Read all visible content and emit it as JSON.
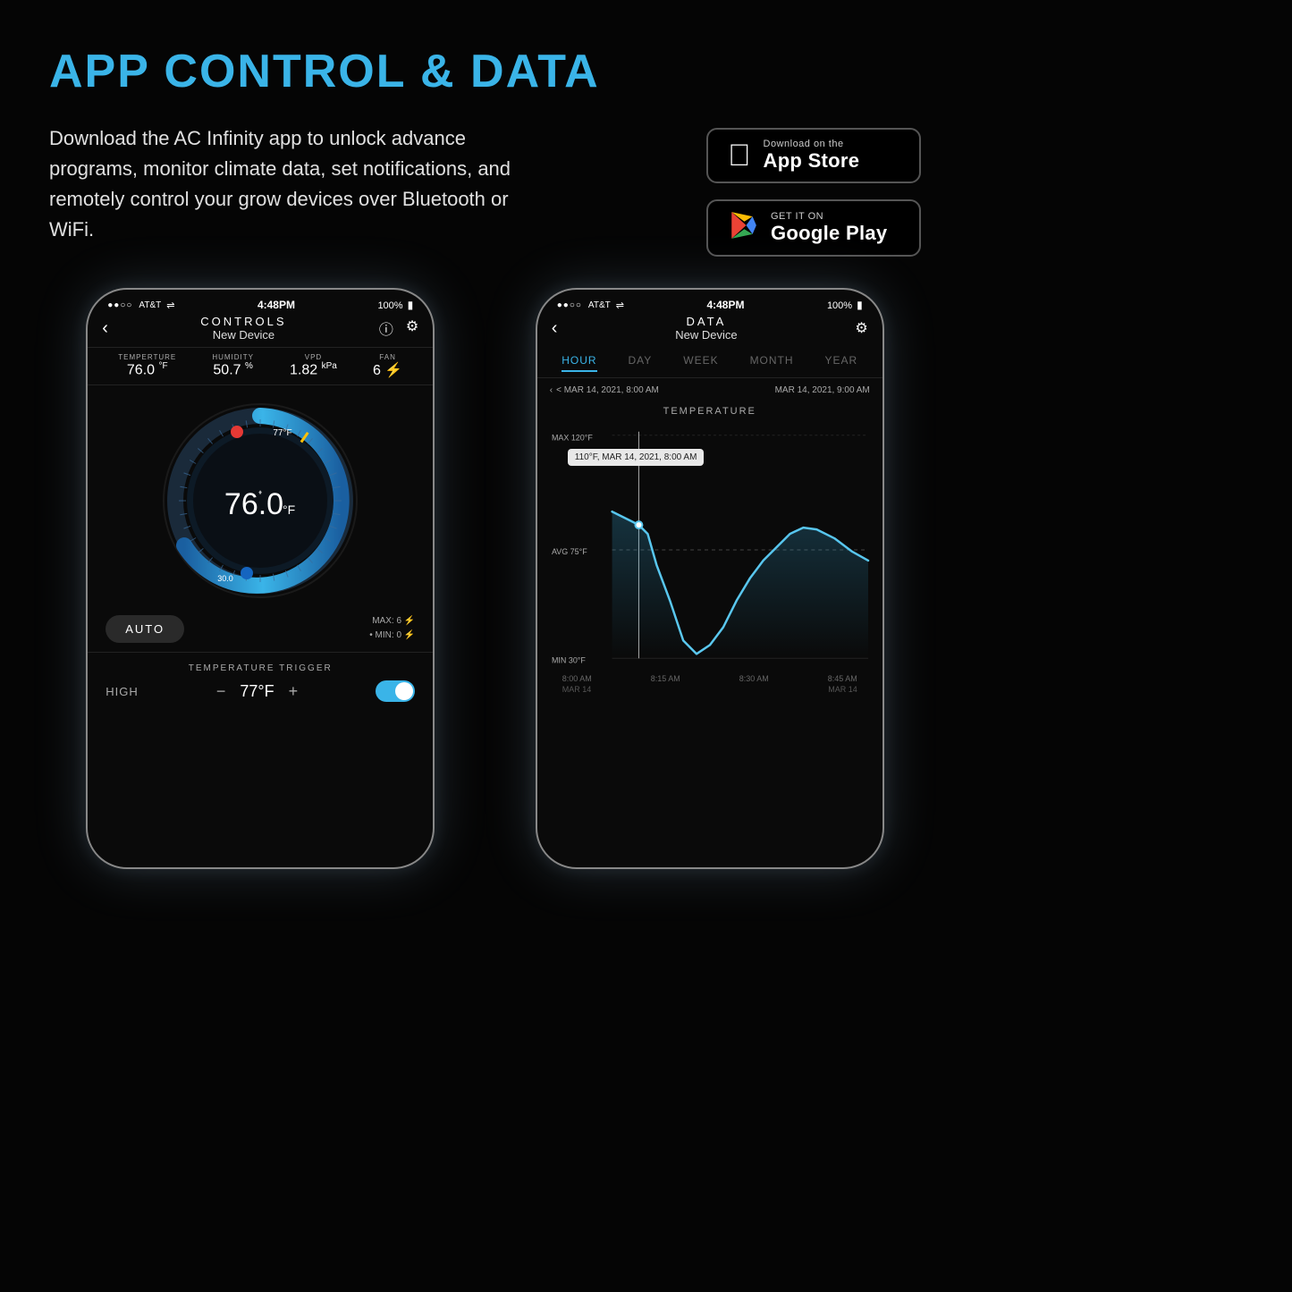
{
  "page": {
    "title": "APP CONTROL & DATA",
    "description": "Download the AC Infinity app to unlock advance programs, monitor climate data, set notifications, and remotely control your grow devices over Bluetooth or WiFi.",
    "background_color": "#050505"
  },
  "store_buttons": {
    "appstore": {
      "small_text": "Download on the",
      "large_text": "App Store",
      "icon": "apple"
    },
    "googleplay": {
      "small_text": "GET IT ON",
      "large_text": "Google Play",
      "icon": "google-play"
    }
  },
  "phone_controls": {
    "status_bar": {
      "left": "●●○○ AT&T  ▲",
      "center": "4:48PM",
      "right": "100%"
    },
    "header_title": "CONTROLS",
    "header_sub": "New Device",
    "metrics": [
      {
        "label": "TEMPERTURE",
        "value": "76.0 °F"
      },
      {
        "label": "HUMIDITY",
        "value": "50.7 %"
      },
      {
        "label": "VPD",
        "value": "1.82 kPa"
      },
      {
        "label": "FAN",
        "value": "6 ⚡"
      }
    ],
    "gauge_temp": "♦76.0°F",
    "gauge_temp_marker": "77°F",
    "auto_button": "AUTO",
    "max_text": "MAX: 6 ⚡",
    "min_text": "• MIN: 0 ⚡",
    "trigger_title": "TEMPERATURE TRIGGER",
    "trigger_label": "HIGH",
    "trigger_value": "77°F"
  },
  "phone_data": {
    "status_bar": {
      "left": "●●○○ AT&T  ▲",
      "center": "4:48PM",
      "right": "100%"
    },
    "header_title": "DATA",
    "header_sub": "New Device",
    "tabs": [
      {
        "label": "HOUR",
        "active": true
      },
      {
        "label": "DAY",
        "active": false
      },
      {
        "label": "WEEK",
        "active": false
      },
      {
        "label": "MONTH",
        "active": false
      },
      {
        "label": "YEAR",
        "active": false
      }
    ],
    "date_left": "< MAR 14, 2021, 8:00 AM",
    "date_right": "MAR 14, 2021, 9:00 AM",
    "chart_title": "TEMPERATURE",
    "tooltip": "110°F, MAR 14, 2021, 8:00 AM",
    "y_labels": [
      {
        "value": "MAX 120°F",
        "y_pct": 0
      },
      {
        "value": "AVG 75°F",
        "y_pct": 50
      },
      {
        "value": "MIN 30°F",
        "y_pct": 100
      }
    ],
    "x_labels": [
      "8:00 AM",
      "8:15 AM",
      "8:30 AM",
      "8:45 AM"
    ],
    "x_bottom": [
      "MAR 14",
      "",
      "",
      "MAR 14"
    ]
  }
}
